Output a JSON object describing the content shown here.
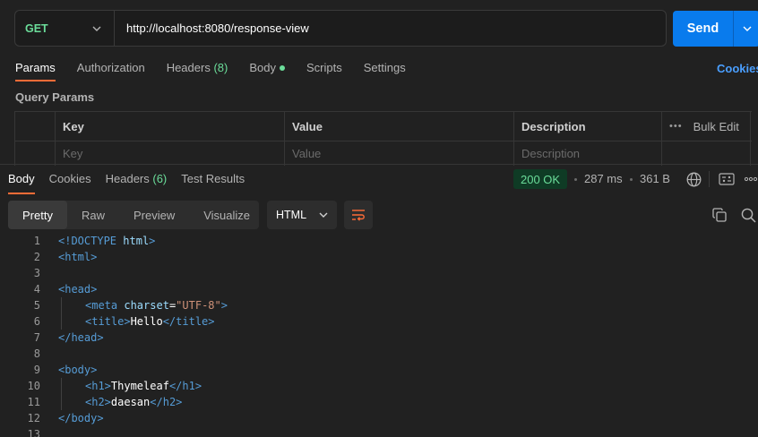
{
  "request": {
    "method": "GET",
    "url": "http://localhost:8080/response-view",
    "send_label": "Send"
  },
  "request_tabs": [
    {
      "label": "Params",
      "active": true
    },
    {
      "label": "Authorization"
    },
    {
      "label": "Headers",
      "count": "(8)"
    },
    {
      "label": "Body",
      "indicator": "green-dot"
    },
    {
      "label": "Scripts"
    },
    {
      "label": "Settings"
    }
  ],
  "cookies_link": "Cookies",
  "query_params": {
    "title": "Query Params",
    "headers": [
      "Key",
      "Value",
      "Description"
    ],
    "bulk_edit": "Bulk Edit",
    "placeholders": {
      "key": "Key",
      "value": "Value",
      "description": "Description"
    }
  },
  "response": {
    "tabs": [
      {
        "label": "Body",
        "active": true
      },
      {
        "label": "Cookies"
      },
      {
        "label": "Headers",
        "count": "(6)"
      },
      {
        "label": "Test Results"
      }
    ],
    "status": "200 OK",
    "time": "287 ms",
    "size": "361 B",
    "view_modes": [
      "Pretty",
      "Raw",
      "Preview",
      "Visualize"
    ],
    "active_view": "Pretty",
    "language": "HTML"
  },
  "code_lines": [
    {
      "n": "1"
    },
    {
      "n": "2"
    },
    {
      "n": "3"
    },
    {
      "n": "4"
    },
    {
      "n": "5"
    },
    {
      "n": "6"
    },
    {
      "n": "7"
    },
    {
      "n": "8"
    },
    {
      "n": "9"
    },
    {
      "n": "10"
    },
    {
      "n": "11"
    },
    {
      "n": "12"
    },
    {
      "n": "13"
    }
  ],
  "code": {
    "l1_doctype": "<!DOCTYPE",
    "l1_html": "html",
    "l1_close": ">",
    "l2": "<html>",
    "l4": "<head>",
    "l5_open": "<meta",
    "l5_attr": "charset",
    "l5_eq": "=",
    "l5_val": "\"UTF-8\"",
    "l5_close": ">",
    "l6_open": "<title>",
    "l6_text": "Hello",
    "l6_close": "</title>",
    "l7": "</head>",
    "l9": "<body>",
    "l10_open": "<h1>",
    "l10_text": "Thymeleaf",
    "l10_close": "</h1>",
    "l11_open": "<h2>",
    "l11_text": "daesan",
    "l11_close": "</h2>",
    "l12": "</body>"
  },
  "colors": {
    "accent_orange": "#ff6c37",
    "send_blue": "#097bed",
    "status_green": "#6bdd9a"
  }
}
